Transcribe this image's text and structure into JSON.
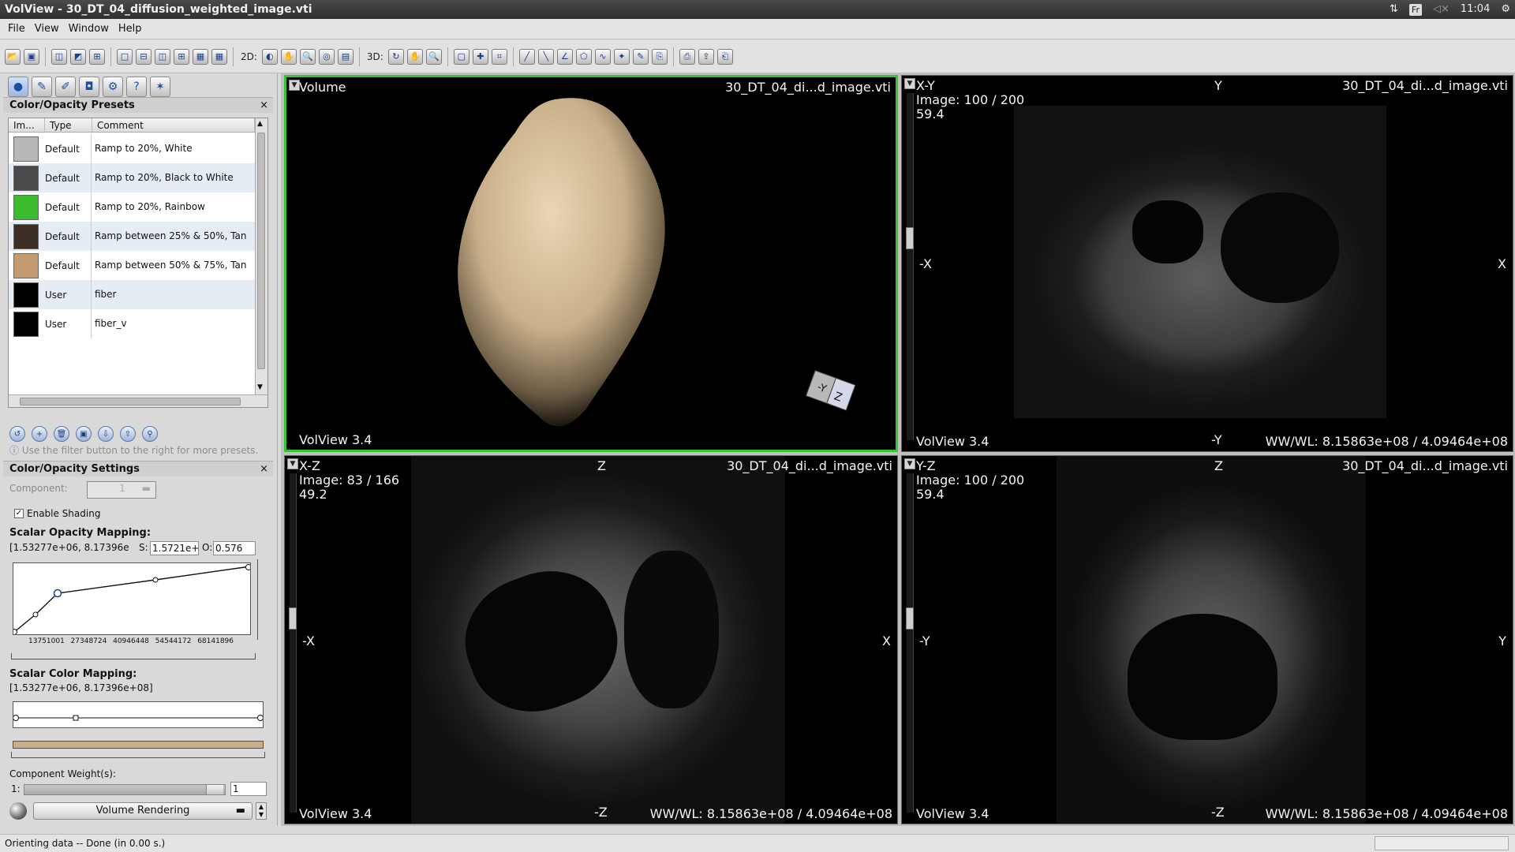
{
  "window": {
    "title": "VolView - 30_DT_04_diffusion_weighted_image.vti"
  },
  "tray": {
    "keyboard": "Fr",
    "clock": "11:04"
  },
  "menu": [
    "File",
    "View",
    "Window",
    "Help"
  ],
  "toolbar": {
    "label_2d": "2D:",
    "label_3d": "3D:"
  },
  "presets": {
    "title": "Color/Opacity Presets",
    "close": "×",
    "columns": [
      "Im...",
      "Type",
      "Comment"
    ],
    "rows": [
      {
        "type": "Default",
        "comment": "Ramp to 20%, White",
        "thumb": "#b8b8b8"
      },
      {
        "type": "Default",
        "comment": "Ramp to 20%, Black to White",
        "thumb": "#4a4a4a"
      },
      {
        "type": "Default",
        "comment": "Ramp to 20%, Rainbow",
        "thumb": "#3dbb2e"
      },
      {
        "type": "Default",
        "comment": "Ramp between 25% & 50%, Tan",
        "thumb": "#3a2e25"
      },
      {
        "type": "Default",
        "comment": "Ramp between 50% & 75%, Tan",
        "thumb": "#c59c72"
      },
      {
        "type": "User",
        "comment": "fiber",
        "thumb": "#000000"
      },
      {
        "type": "User",
        "comment": "fiber_v",
        "thumb": "#000000"
      }
    ],
    "hint": "Use the filter button to the right for more presets."
  },
  "settings": {
    "title": "Color/Opacity Settings",
    "close": "×",
    "component_label": "Component:",
    "component_value": "1",
    "shading_label": "Enable Shading",
    "shading_checked": true,
    "opacity_title": "Scalar Opacity Mapping:",
    "opacity_range": "[1.53277e+06, 8.17396e",
    "s_label": "S:",
    "s_value": "1.5721e+",
    "o_label": "O:",
    "o_value": "0.576",
    "opacity_ticks": [
      "13751001",
      "27348724",
      "40946448",
      "54544172",
      "68141896"
    ],
    "color_title": "Scalar Color Mapping:",
    "color_range": "[1.53277e+06, 8.17396e+08]",
    "color_ramp": "#c8ad86",
    "weights_title": "Component Weight(s):",
    "weight_label": "1:",
    "weight_value": "1",
    "render_mode": "Volume Rendering"
  },
  "views": {
    "volume": {
      "name": "Volume",
      "file": "30_DT_04_di...d_image.vti",
      "footer": "VolView 3.4",
      "cube_a": "-Y",
      "cube_b": "Z"
    },
    "xy": {
      "name": "X-Y",
      "image": "Image: 100 / 200",
      "value": "59.4",
      "file": "30_DT_04_di...d_image.vti",
      "top": "Y",
      "bottom": "-Y",
      "left": "-X",
      "right": "X",
      "footer": "VolView 3.4",
      "wwwl": "WW/WL: 8.15863e+08 / 4.09464e+08"
    },
    "xz": {
      "name": "X-Z",
      "image": "Image: 83 / 166",
      "value": "49.2",
      "file": "30_DT_04_di...d_image.vti",
      "top": "Z",
      "bottom": "-Z",
      "left": "-X",
      "right": "X",
      "footer": "VolView 3.4",
      "wwwl": "WW/WL: 8.15863e+08 / 4.09464e+08"
    },
    "yz": {
      "name": "Y-Z",
      "image": "Image: 100 / 200",
      "value": "59.4",
      "file": "30_DT_04_di...d_image.vti",
      "top": "Z",
      "bottom": "-Z",
      "left": "-Y",
      "right": "Y",
      "footer": "VolView 3.4",
      "wwwl": "WW/WL: 8.15863e+08 / 4.09464e+08"
    }
  },
  "status": {
    "text": "Orienting data -- Done (in 0.00 s.)"
  }
}
